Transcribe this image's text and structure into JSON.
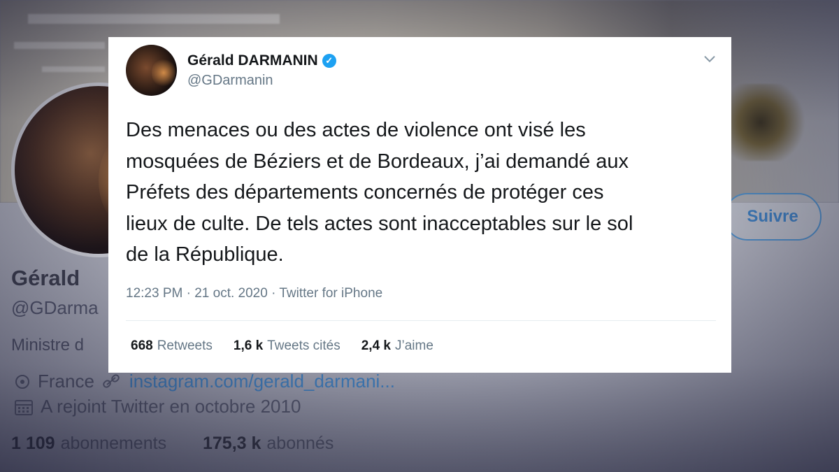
{
  "background_profile": {
    "follow_label": "Suivre",
    "name": "Gérald",
    "handle": "@GDarma",
    "bio": "Ministre d",
    "location": "France",
    "link": "instagram.com/gerald_darmani...",
    "joined": "A rejoint Twitter en octobre 2010",
    "following_count": "1 109",
    "following_label": "abonnements",
    "followers_count": "175,3 k",
    "followers_label": "abonnés"
  },
  "tweet": {
    "display_name": "Gérald DARMANIN",
    "verified_icon": "check-icon",
    "handle": "@GDarmanin",
    "text_lines": [
      "Des menaces ou des actes de violence ont visé les",
      "mosquées de Béziers et de Bordeaux, j’ai demandé aux",
      "Préfets des départements concernés de protéger ces",
      "lieux de culte. De tels actes sont inacceptables sur le sol",
      "de la République."
    ],
    "time": "12:23 PM",
    "date": "21 oct. 2020",
    "source": "Twitter for iPhone",
    "separator": " · ",
    "retweets_count": "668",
    "retweets_label": "Retweets",
    "quotes_count": "1,6 k",
    "quotes_label": "Tweets cités",
    "likes_count": "2,4 k",
    "likes_label": "J’aime"
  },
  "colors": {
    "accent": "#1da1f2",
    "text_primary": "#14171a",
    "text_secondary": "#657786"
  }
}
